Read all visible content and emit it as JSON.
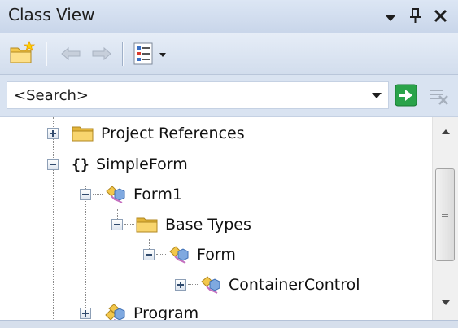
{
  "window": {
    "title": "Class View",
    "pin_icon": "pin-icon",
    "close_icon": "close-icon",
    "menu_icon": "window-menu-icon"
  },
  "toolbar": {
    "tools": [
      {
        "name": "new-folder-icon"
      },
      {
        "name": "back-arrow-icon"
      },
      {
        "name": "forward-arrow-icon"
      },
      {
        "name": "settings-list-icon"
      }
    ]
  },
  "search": {
    "value": "<Search>",
    "placeholder": "<Search>"
  },
  "tree": {
    "nodes": [
      {
        "label": "Project References",
        "icon": "folder-icon",
        "expander": "plus"
      },
      {
        "label": "SimpleForm",
        "icon": "namespace-braces-icon",
        "expander": "minus"
      },
      {
        "label": "Form1",
        "icon": "class-icon",
        "expander": "minus"
      },
      {
        "label": "Base Types",
        "icon": "folder-icon",
        "expander": "minus"
      },
      {
        "label": "Form",
        "icon": "class-icon",
        "expander": "minus"
      },
      {
        "label": "ContainerControl",
        "icon": "class-icon",
        "expander": "plus"
      },
      {
        "label": "Program",
        "icon": "class-icon",
        "expander": "plus"
      }
    ],
    "namespace_symbol": "{}"
  },
  "colors": {
    "panel_bg": "#d7e1ef",
    "tree_bg": "#ffffff",
    "go_button": "#2aa34a",
    "folder": "#f3c74b",
    "class_icon": "#5b8fd0"
  }
}
